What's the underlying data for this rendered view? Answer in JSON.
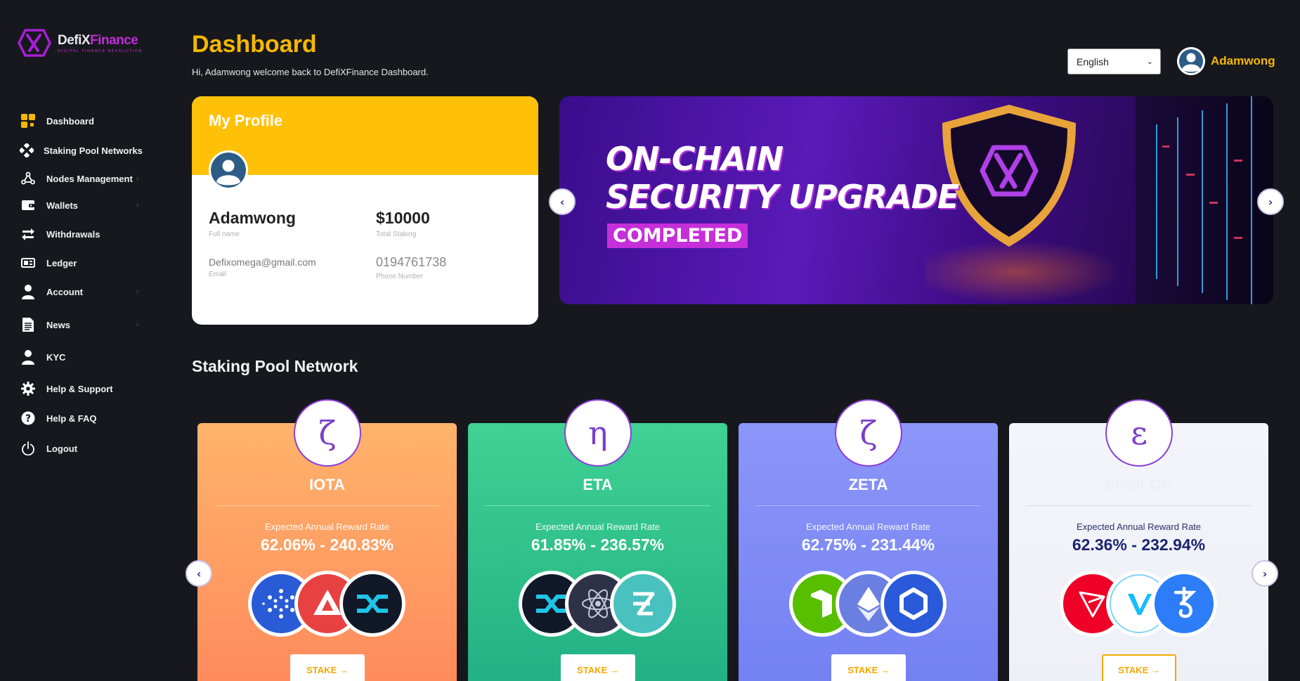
{
  "brand": {
    "name_part1": "DefiX",
    "name_part2": "Finance",
    "tagline": "DIGITAL FINANCE REVOLUTION"
  },
  "sidebar": {
    "items": [
      {
        "label": "Dashboard",
        "icon": "dashboard-icon",
        "has_submenu": false
      },
      {
        "label": "Staking Pool Networks",
        "icon": "staking-icon",
        "has_submenu": false
      },
      {
        "label": "Nodes Management",
        "icon": "nodes-icon",
        "has_submenu": true
      },
      {
        "label": "Wallets",
        "icon": "wallet-icon",
        "has_submenu": true
      },
      {
        "label": "Withdrawals",
        "icon": "transfer-icon",
        "has_submenu": false
      },
      {
        "label": "Ledger",
        "icon": "ledger-icon",
        "has_submenu": false
      },
      {
        "label": "Account",
        "icon": "user-icon",
        "has_submenu": true
      },
      {
        "label": "News",
        "icon": "document-icon",
        "has_submenu": true
      },
      {
        "label": "KYC",
        "icon": "user-icon",
        "has_submenu": false
      },
      {
        "label": "Help & Support",
        "icon": "gear-icon",
        "has_submenu": false
      },
      {
        "label": "Help & FAQ",
        "icon": "question-icon",
        "has_submenu": false
      },
      {
        "label": "Logout",
        "icon": "power-icon",
        "has_submenu": false
      }
    ]
  },
  "header": {
    "title": "Dashboard",
    "welcome": "Hi, Adamwong welcome back to DefiXFinance Dashboard.",
    "language": "English",
    "username": "Adamwong"
  },
  "profile": {
    "title": "My Profile",
    "full_name": "Adamwong",
    "full_name_label": "Full name",
    "total_staking": "$10000",
    "total_staking_label": "Total Staking",
    "email": "Defixomega@gmail.com",
    "email_label": "Email",
    "phone": "0194761738",
    "phone_label": "Phone Number"
  },
  "banner": {
    "line1": "ON-CHAIN",
    "line2": "SECURITY UPGRADE",
    "tag": "COMPLETED"
  },
  "pools_section": {
    "title": "Staking Pool Network",
    "pools": [
      {
        "symbol": "ζ",
        "name": "IOTA",
        "rate_label": "Expected Annual Reward Rate",
        "rate": "62.06% - 240.83%",
        "stake_label": "STAKE →",
        "coins": [
          "cardano-icon",
          "avalanche-icon",
          "synthetix-icon"
        ],
        "color_top": "#ffb36b",
        "color_bottom": "#ff8a5c"
      },
      {
        "symbol": "η",
        "name": "ETA",
        "rate_label": "Expected Annual Reward Rate",
        "rate": "61.85% - 236.57%",
        "stake_label": "STAKE →",
        "coins": [
          "synthetix-icon",
          "cosmos-icon",
          "zilliqa-icon"
        ],
        "color_top": "#3fd194",
        "color_bottom": "#22b083"
      },
      {
        "symbol": "ζ",
        "name": "ZETA",
        "rate_label": "Expected Annual Reward Rate",
        "rate": "62.75% - 231.44%",
        "stake_label": "STAKE →",
        "coins": [
          "neo-icon",
          "ethereum-icon",
          "chainlink-icon"
        ],
        "color_top": "#8c96f9",
        "color_bottom": "#7380f2"
      },
      {
        "symbol": "ε",
        "name": "EPSILON",
        "rate_label": "Expected Annual Reward Rate",
        "rate": "62.36% - 232.94%",
        "stake_label": "STAKE →",
        "coins": [
          "tron-icon",
          "vechain-icon",
          "tezos-icon"
        ],
        "color_top": "#f4f5fa",
        "color_bottom": "#eef0f7"
      }
    ]
  },
  "colors": {
    "accent": "#f5b800",
    "brand_purple": "#c02bd9",
    "background": "#17181d"
  }
}
